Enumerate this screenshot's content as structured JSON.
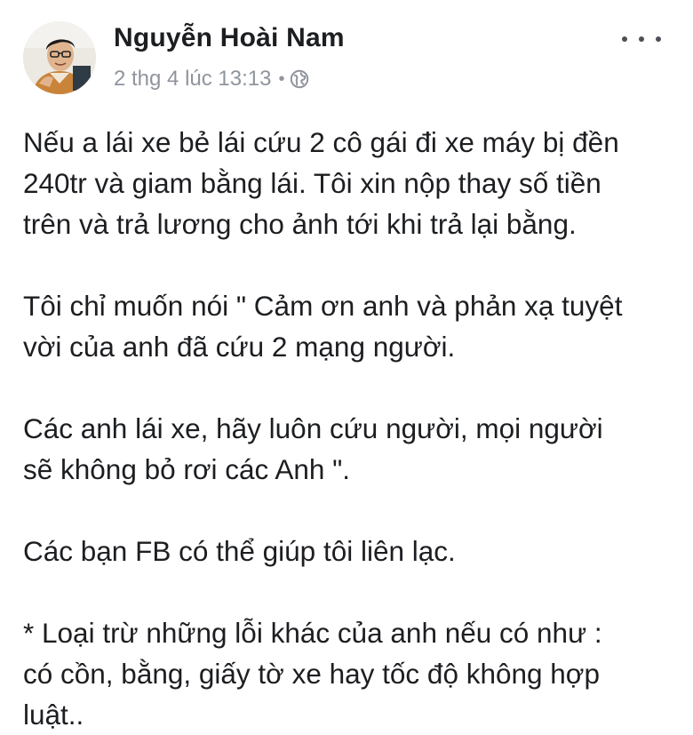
{
  "post": {
    "author_name": "Nguyễn Hoài Nam",
    "timestamp": "2 thg 4 lúc 13:13",
    "separator": "•",
    "privacy_icon": "globe-icon",
    "more_icon": "more-options-icon",
    "paragraphs": [
      {
        "lines": [
          "Nếu a lái xe bẻ lái cứu 2 cô gái đi xe máy bị đền",
          "240tr và giam bằng lái. Tôi xin nộp thay số tiền",
          "trên và trả lương cho ảnh tới khi trả lại bằng."
        ]
      },
      {
        "lines": [
          "Tôi chỉ muốn nói \" Cảm ơn anh và phản xạ tuyệt",
          "vời của anh đã cứu 2 mạng người."
        ]
      },
      {
        "lines": [
          "Các anh lái  xe, hãy luôn cứu người, mọi người",
          "sẽ không bỏ rơi các Anh \"."
        ]
      },
      {
        "lines": [
          "Các bạn FB có thể giúp tôi liên lạc."
        ]
      },
      {
        "lines": [
          "* Loại trừ những lỗi khác của anh nếu có như :",
          "có cồn, bằng, giấy tờ xe hay tốc độ không hợp",
          "luật.."
        ]
      }
    ]
  }
}
